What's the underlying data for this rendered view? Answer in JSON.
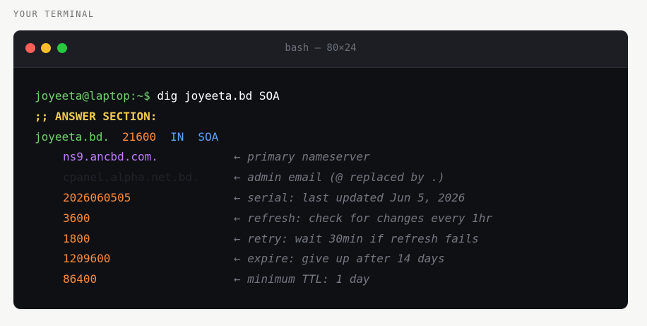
{
  "header": {
    "label": "YOUR TERMINAL"
  },
  "terminal": {
    "title": "bash — 80×24",
    "prompt": "joyeeta@laptop:~$",
    "command": "dig joyeeta.bd SOA",
    "answer_header": ";; ANSWER SECTION:",
    "record": {
      "name": "joyeeta.bd.",
      "ttl": "21600",
      "class": "IN",
      "type": "SOA"
    },
    "fields": [
      {
        "value": "ns9.ancbd.com.",
        "comment": "← primary nameserver"
      },
      {
        "value": "cpanel.alpha.net.bd.",
        "comment": "← admin email (@ replaced by .)"
      },
      {
        "value": "2026060505",
        "comment": "← serial: last updated Jun 5, 2026"
      },
      {
        "value": "3600",
        "comment": "← refresh: check for changes every 1hr"
      },
      {
        "value": "1800",
        "comment": "← retry: wait 30min if refresh fails"
      },
      {
        "value": "1209600",
        "comment": "← expire: give up after 14 days"
      },
      {
        "value": "86400",
        "comment": "← minimum TTL: 1 day"
      }
    ],
    "colors": {
      "background": "#0e1014",
      "titlebar": "#1c1e24",
      "prompt": "#6fd36b",
      "section": "#f2c94c",
      "number": "#ff8c3a",
      "keyword": "#5aa2ff",
      "nameserver": "#c07cff",
      "comment": "#737780"
    },
    "window_controls": [
      "close-dot",
      "minimize-dot",
      "maximize-dot"
    ]
  }
}
